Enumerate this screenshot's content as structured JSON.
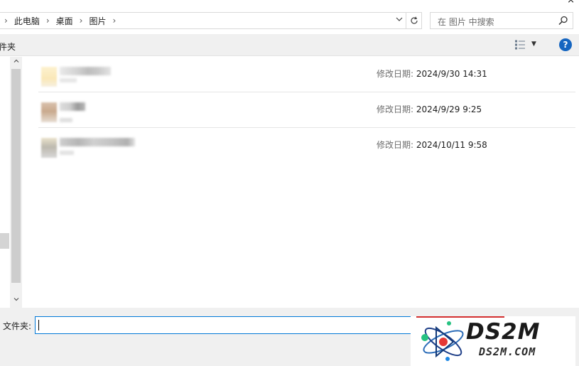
{
  "window": {
    "close_glyph": "×"
  },
  "breadcrumb": {
    "items": [
      "此电脑",
      "桌面",
      "图片"
    ],
    "separator": "›"
  },
  "address_bar": {
    "dropdown_glyph": "⌄"
  },
  "search": {
    "placeholder": "在 图片 中搜索"
  },
  "command_bar": {
    "left_label": "件夹"
  },
  "help": {
    "label": "?"
  },
  "files": [
    {
      "name": "",
      "date_label": "修改日期:",
      "date_value": "2024/9/30 14:31"
    },
    {
      "name": "",
      "date_label": "修改日期:",
      "date_value": "2024/9/29 9:25"
    },
    {
      "name": "",
      "date_label": "修改日期:",
      "date_value": "2024/10/11 9:58"
    }
  ],
  "bottom": {
    "folder_label": "文件夹:",
    "folder_value": ""
  },
  "watermark": {
    "title": "DS2M",
    "subtitle": "DS2M.COM"
  },
  "colors": {
    "accent": "#0078d7",
    "help": "#1565c0",
    "watermark_red": "#d32f2f"
  }
}
